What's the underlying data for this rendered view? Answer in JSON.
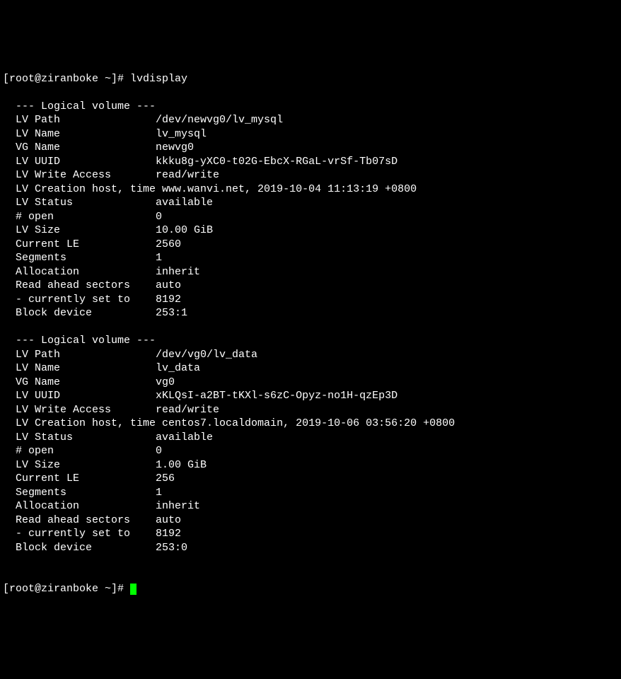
{
  "prompt1": "[root@ziranboke ~]# ",
  "command": "lvdisplay",
  "prompt2": "[root@ziranboke ~]# ",
  "volumes": [
    {
      "header": "  --- Logical volume ---",
      "fields": [
        {
          "label": "  LV Path",
          "value": "/dev/newvg0/lv_mysql"
        },
        {
          "label": "  LV Name",
          "value": "lv_mysql"
        },
        {
          "label": "  VG Name",
          "value": "newvg0"
        },
        {
          "label": "  LV UUID",
          "value": "kkku8g-yXC0-t02G-EbcX-RGaL-vrSf-Tb07sD"
        },
        {
          "label": "  LV Write Access",
          "value": "read/write"
        },
        {
          "label": "  LV Creation host, time",
          "value": "www.wanvi.net, 2019-10-04 11:13:19 +0800",
          "tight": true
        },
        {
          "label": "  LV Status",
          "value": "available"
        },
        {
          "label": "  # open",
          "value": "0"
        },
        {
          "label": "  LV Size",
          "value": "10.00 GiB"
        },
        {
          "label": "  Current LE",
          "value": "2560"
        },
        {
          "label": "  Segments",
          "value": "1"
        },
        {
          "label": "  Allocation",
          "value": "inherit"
        },
        {
          "label": "  Read ahead sectors",
          "value": "auto"
        },
        {
          "label": "  - currently set to",
          "value": "8192"
        },
        {
          "label": "  Block device",
          "value": "253:1"
        }
      ]
    },
    {
      "header": "  --- Logical volume ---",
      "fields": [
        {
          "label": "  LV Path",
          "value": "/dev/vg0/lv_data"
        },
        {
          "label": "  LV Name",
          "value": "lv_data"
        },
        {
          "label": "  VG Name",
          "value": "vg0"
        },
        {
          "label": "  LV UUID",
          "value": "xKLQsI-a2BT-tKXl-s6zC-Opyz-no1H-qzEp3D"
        },
        {
          "label": "  LV Write Access",
          "value": "read/write"
        },
        {
          "label": "  LV Creation host, time",
          "value": "centos7.localdomain, 2019-10-06 03:56:20 +0800",
          "tight": true
        },
        {
          "label": "  LV Status",
          "value": "available"
        },
        {
          "label": "  # open",
          "value": "0"
        },
        {
          "label": "  LV Size",
          "value": "1.00 GiB"
        },
        {
          "label": "  Current LE",
          "value": "256"
        },
        {
          "label": "  Segments",
          "value": "1"
        },
        {
          "label": "  Allocation",
          "value": "inherit"
        },
        {
          "label": "  Read ahead sectors",
          "value": "auto"
        },
        {
          "label": "  - currently set to",
          "value": "8192"
        },
        {
          "label": "  Block device",
          "value": "253:0"
        }
      ]
    }
  ]
}
